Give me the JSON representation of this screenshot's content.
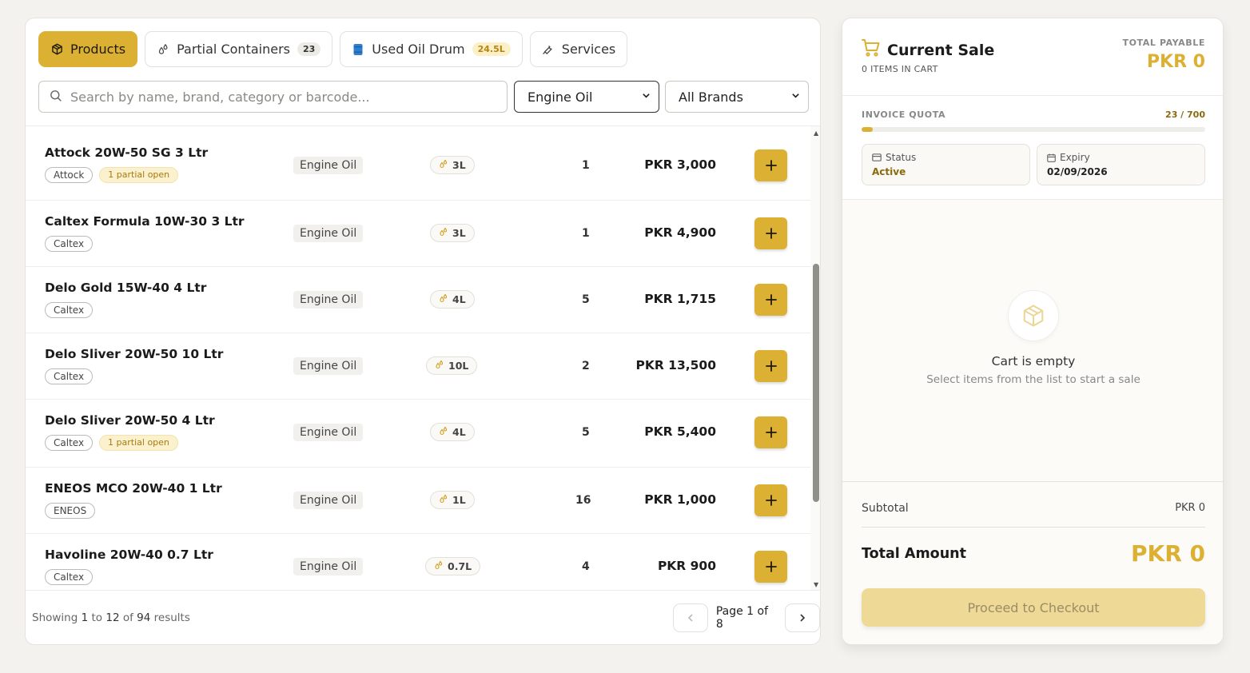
{
  "colors": {
    "accent": "#dcb033",
    "accent_light": "#eed996",
    "partial_bg": "#fbf1cf"
  },
  "tabs": [
    {
      "label": "Products",
      "icon": "box-icon",
      "active": true
    },
    {
      "label": "Partial Containers",
      "icon": "drops-icon",
      "count": "23"
    },
    {
      "label": "Used Oil Drum",
      "icon": "drum-icon",
      "count": "24.5L"
    },
    {
      "label": "Services",
      "icon": "wrench-icon"
    }
  ],
  "search": {
    "placeholder": "Search by name, brand, category or barcode...",
    "value": ""
  },
  "filters": {
    "category": "Engine Oil",
    "brand": "All Brands"
  },
  "products": [
    {
      "name": "Attock 20W-50 SG 3 Ltr",
      "brand": "Attock",
      "partial": "1 partial open",
      "category": "Engine Oil",
      "volume": "3L",
      "qty": "1",
      "price": "PKR 3,000"
    },
    {
      "name": "Caltex Formula 10W-30 3 Ltr",
      "brand": "Caltex",
      "partial": "",
      "category": "Engine Oil",
      "volume": "3L",
      "qty": "1",
      "price": "PKR 4,900"
    },
    {
      "name": "Delo Gold 15W-40 4 Ltr",
      "brand": "Caltex",
      "partial": "",
      "category": "Engine Oil",
      "volume": "4L",
      "qty": "5",
      "price": "PKR 1,715"
    },
    {
      "name": "Delo Sliver 20W-50 10 Ltr",
      "brand": "Caltex",
      "partial": "",
      "category": "Engine Oil",
      "volume": "10L",
      "qty": "2",
      "price": "PKR 13,500"
    },
    {
      "name": "Delo Sliver 20W-50 4 Ltr",
      "brand": "Caltex",
      "partial": "1 partial open",
      "category": "Engine Oil",
      "volume": "4L",
      "qty": "5",
      "price": "PKR 5,400"
    },
    {
      "name": "ENEOS MCO 20W-40 1 Ltr",
      "brand": "ENEOS",
      "partial": "",
      "category": "Engine Oil",
      "volume": "1L",
      "qty": "16",
      "price": "PKR 1,000"
    },
    {
      "name": "Havoline 20W-40 0.7 Ltr",
      "brand": "Caltex",
      "partial": "",
      "category": "Engine Oil",
      "volume": "0.7L",
      "qty": "4",
      "price": "PKR 900"
    }
  ],
  "pagination": {
    "showing_prefix": "Showing",
    "from": "1",
    "to_word": "to",
    "to": "12",
    "of_word": "of",
    "total": "94",
    "suffix": "results",
    "page_label": "Page 1 of 8"
  },
  "cart": {
    "title": "Current Sale",
    "items_label": "0 ITEMS IN CART",
    "total_payable_label": "TOTAL PAYABLE",
    "total_payable_value": "PKR 0",
    "quota_label": "INVOICE QUOTA",
    "quota_value": "23 / 700",
    "quota_used": 23,
    "quota_max": 700,
    "status_label": "Status",
    "status_value": "Active",
    "expiry_label": "Expiry",
    "expiry_value": "02/09/2026",
    "empty_title": "Cart is empty",
    "empty_sub": "Select items from the list to start a sale",
    "subtotal_label": "Subtotal",
    "subtotal_value": "PKR 0",
    "total_label": "Total Amount",
    "total_value": "PKR 0",
    "checkout_label": "Proceed to Checkout"
  }
}
